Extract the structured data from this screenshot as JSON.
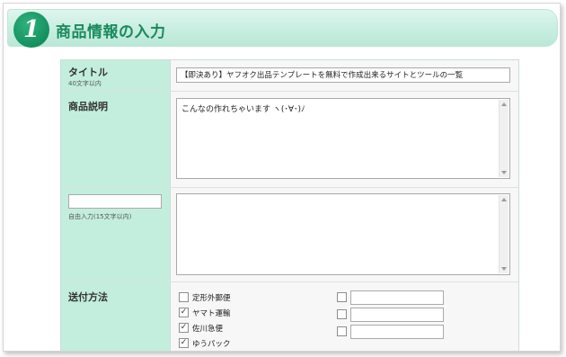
{
  "header": {
    "step_number": "1",
    "title": "商品情報の入力"
  },
  "title_row": {
    "label": "タイトル",
    "sublabel": "40文字以内",
    "value": "【即決あり】ヤフオク出品テンプレートを無料で作成出来るサイトとツールの一覧"
  },
  "description_row": {
    "label": "商品説明",
    "value": "こんなの作れちゃいます ヽ(･∀･)ﾉ"
  },
  "custom_row": {
    "label_value": "",
    "sublabel": "自由入力(15文字以内)",
    "value": ""
  },
  "shipping_row": {
    "label": "送付方法",
    "options": [
      {
        "label": "定形外郵便",
        "checked": false
      },
      {
        "label": "ヤマト運輸",
        "checked": true
      },
      {
        "label": "佐川急便",
        "checked": true
      },
      {
        "label": "ゆうパック",
        "checked": true
      }
    ],
    "custom_options": [
      {
        "checked": false,
        "value": ""
      },
      {
        "checked": false,
        "value": ""
      },
      {
        "checked": false,
        "value": ""
      }
    ]
  }
}
